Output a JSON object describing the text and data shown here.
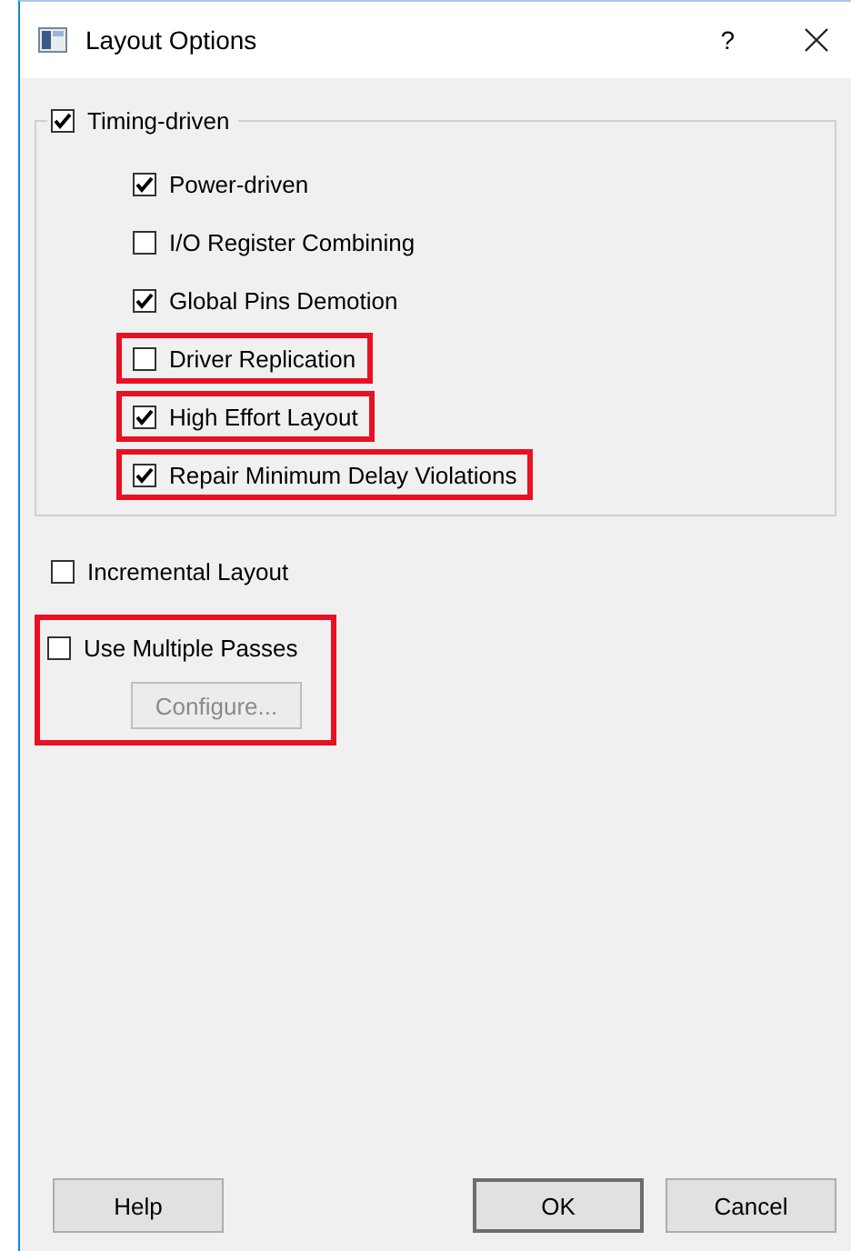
{
  "window": {
    "title": "Layout Options",
    "help_button": "?"
  },
  "timing_group": {
    "label": "Timing-driven",
    "checked": true,
    "highlighted": false,
    "options": [
      {
        "label": "Power-driven",
        "checked": true,
        "highlighted": false
      },
      {
        "label": "I/O Register Combining",
        "checked": false,
        "highlighted": false
      },
      {
        "label": "Global Pins Demotion",
        "checked": true,
        "highlighted": false
      },
      {
        "label": "Driver Replication",
        "checked": false,
        "highlighted": true
      },
      {
        "label": "High Effort Layout",
        "checked": true,
        "highlighted": true
      },
      {
        "label": "Repair Minimum Delay Violations",
        "checked": true,
        "highlighted": true
      }
    ]
  },
  "incremental": {
    "label": "Incremental Layout",
    "checked": false,
    "highlighted": false
  },
  "multiple_passes": {
    "label": "Use Multiple Passes",
    "checked": false,
    "highlighted": true,
    "configure": {
      "label": "Configure...",
      "disabled": true
    }
  },
  "buttons": [
    {
      "label": "Help",
      "default": false
    },
    {
      "label": "OK",
      "default": true
    },
    {
      "label": "Cancel",
      "default": false
    }
  ]
}
